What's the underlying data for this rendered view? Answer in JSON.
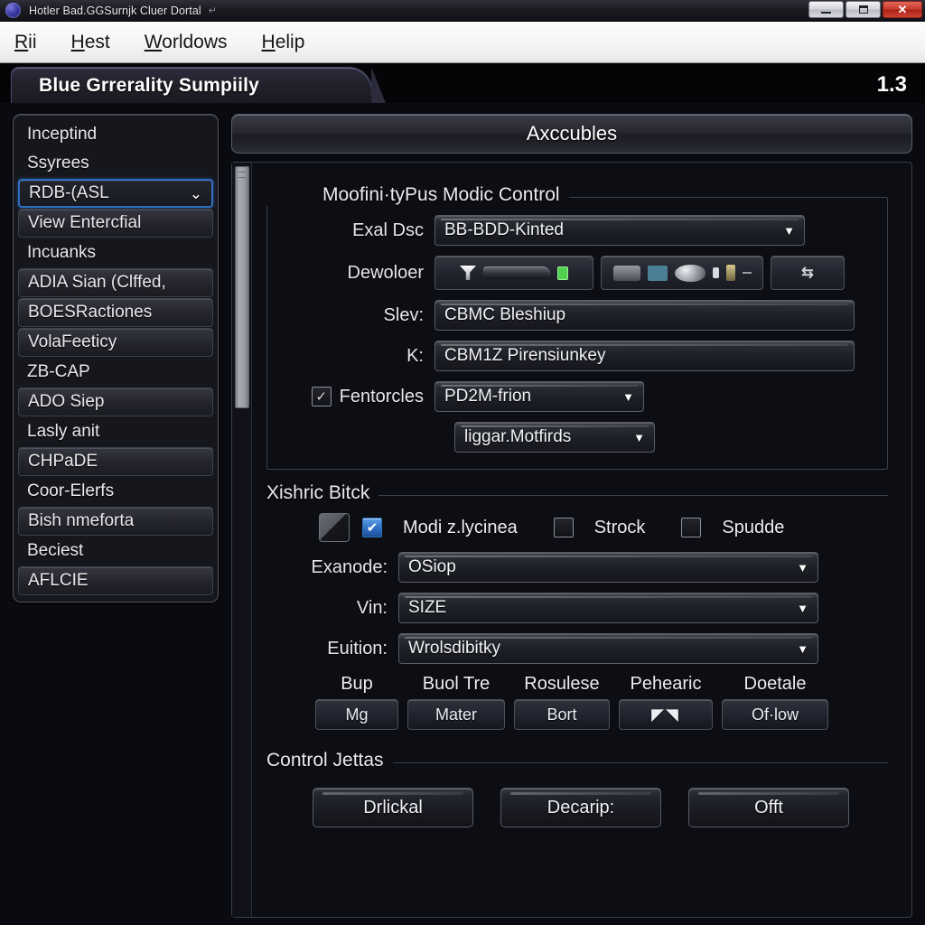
{
  "titlebar": {
    "title": "Hotler Bad.GGSurnjk Cluer Dortal",
    "trail": "↵",
    "icon": "app-globe-icon",
    "buttons": {
      "minimize": "minimize",
      "maximize": "maximize",
      "close": "✕"
    }
  },
  "menubar": {
    "items": [
      {
        "acc": "R",
        "rest": "ii"
      },
      {
        "acc": "H",
        "rest": "est"
      },
      {
        "acc": "W",
        "rest": "orldows"
      },
      {
        "acc": "H",
        "rest": "elip"
      }
    ]
  },
  "tab": {
    "label": "Blue Grrerality Sumpiily",
    "version": "1.3"
  },
  "sidebar": {
    "items": [
      {
        "label": "Inceptind",
        "style": "plain"
      },
      {
        "label": "Ssyrees",
        "style": "plain"
      },
      {
        "label": "RDB-(ASL",
        "style": "selected",
        "chevron": "⌄"
      },
      {
        "label": "View Entercfial",
        "style": "raised"
      },
      {
        "label": "Incuanks",
        "style": "plain"
      },
      {
        "label": "ADIA Sian (Clffed,",
        "style": "raised"
      },
      {
        "label": "BOESRactiones",
        "style": "raised"
      },
      {
        "label": "VolaFeeticy",
        "style": "raised"
      },
      {
        "label": "ZB-CAP",
        "style": "plain"
      },
      {
        "label": "ADO Siep",
        "style": "raised"
      },
      {
        "label": "Lasly anit",
        "style": "plain"
      },
      {
        "label": "CHPaDE",
        "style": "raised"
      },
      {
        "label": "Coor-Elerfs",
        "style": "plain"
      },
      {
        "label": "Bish nmeforta",
        "style": "raised"
      },
      {
        "label": "Beciest",
        "style": "plain"
      },
      {
        "label": "AFLCIE",
        "style": "raised"
      }
    ]
  },
  "main": {
    "header": "Axccubles",
    "group1": {
      "legend": "Moofini·tyPus Modic Control",
      "exal_dsc": {
        "label": "Exal Dѕc",
        "value": "BB-BDD-Kinted",
        "caret": "▼"
      },
      "dewoloer": {
        "label": "Dewoloer"
      },
      "slev": {
        "label": "Slev:",
        "value": "CBMC Bleshiup"
      },
      "k": {
        "label": "K:",
        "value": "CBM1Z Pirensiunkey"
      },
      "fentorcles": {
        "label": "Fentorcles",
        "checked": "✓",
        "value": "PD2M-frion",
        "caret": "▼"
      },
      "second_combo": {
        "value": "liggar.Motfirds",
        "caret": "▼"
      }
    },
    "group2": {
      "legend": "Xishric Bitck",
      "checks": [
        {
          "label": "Modi z.lycinea",
          "state": "checked",
          "mark": "✔"
        },
        {
          "label": "Strock",
          "state": "unchecked",
          "mark": ""
        },
        {
          "label": "Spudde",
          "state": "unchecked",
          "mark": ""
        }
      ],
      "exanode": {
        "label": "Exanode:",
        "value": "OSiop",
        "caret": "▼"
      },
      "vin": {
        "label": "Vin:",
        "value": "SIZE",
        "caret": "▼"
      },
      "euition": {
        "label": "Euition:",
        "value": "Wrolsdibitky",
        "caret": "▼"
      },
      "buttons": [
        {
          "head": "Bup",
          "label": "Mg"
        },
        {
          "head": "Buol Tre",
          "label": "Mater"
        },
        {
          "head": "Rosulese",
          "label": "Bort"
        },
        {
          "head": "Pehearic",
          "label": "◤◥"
        },
        {
          "head": "Doetale",
          "label": "Of·low"
        }
      ]
    },
    "group3": {
      "legend": "Control Jettas",
      "actions": [
        {
          "label": "Drlickal"
        },
        {
          "label": "Decarip:"
        },
        {
          "label": "Offt"
        }
      ]
    }
  },
  "colors": {
    "accent_blue": "#2f6fc4",
    "window_bg": "#0a0b10",
    "panel_bg": "#16171d",
    "close_red": "#c93a2a",
    "green_led": "#4fd14f"
  }
}
